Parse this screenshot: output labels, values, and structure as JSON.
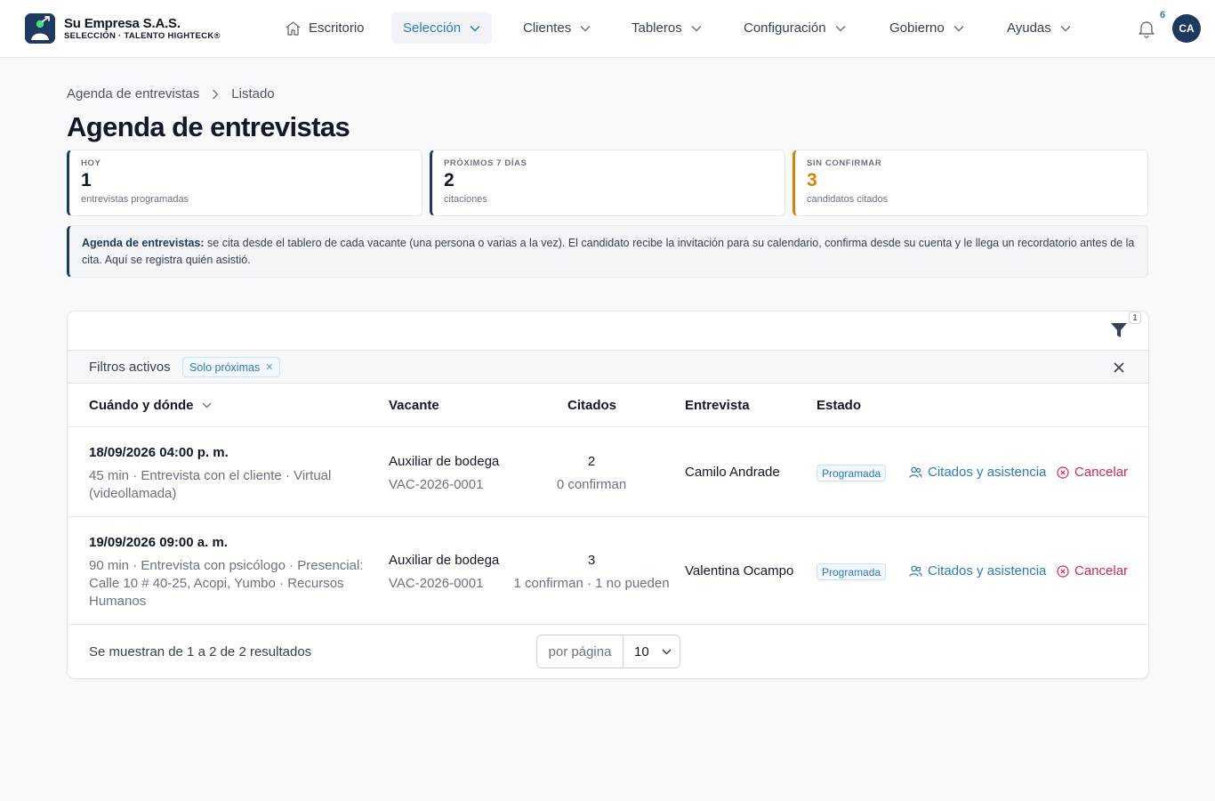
{
  "brand": {
    "name": "Su Empresa S.A.S.",
    "subtitle": "SELECCIÓN · TALENTO HIGHTECK®"
  },
  "nav": {
    "items": [
      {
        "label": "Escritorio",
        "icon": "home-icon"
      },
      {
        "label": "Selección",
        "active": true
      },
      {
        "label": "Clientes"
      },
      {
        "label": "Tableros"
      },
      {
        "label": "Configuración"
      },
      {
        "label": "Gobierno"
      },
      {
        "label": "Ayudas"
      }
    ],
    "notifications_count": "6",
    "avatar_initials": "CA"
  },
  "breadcrumb": [
    "Agenda de entrevistas",
    "Listado"
  ],
  "page_title": "Agenda de entrevistas",
  "stats": [
    {
      "label": "HOY",
      "value": "1",
      "caption": "entrevistas programadas"
    },
    {
      "label": "PRÓXIMOS 7 DÍAS",
      "value": "2",
      "caption": "citaciones"
    },
    {
      "label": "SIN CONFIRMAR",
      "value": "3",
      "caption": "candidatos citados"
    }
  ],
  "info": {
    "title": "Agenda de entrevistas:",
    "text": " se cita desde el tablero de cada vacante (una persona o varias a la vez). El candidato recibe la invitación para su calendario, confirma desde su cuenta y le llega un recordatorio antes de la cita. Aquí se registra quién asistió."
  },
  "table": {
    "filter_count": "1",
    "active_filters_label": "Filtros activos",
    "filter_chip": "Solo próximas",
    "columns": {
      "when": "Cuándo y dónde",
      "vacancy": "Vacante",
      "cited": "Citados",
      "interviewer": "Entrevista",
      "status": "Estado"
    },
    "rows": [
      {
        "date": "18/09/2026 04:00 p. m.",
        "details": "45 min · Entrevista con el cliente · Virtual (videollamada)",
        "vacancy": "Auxiliar de bodega",
        "vacancy_code": "VAC-2026-0001",
        "cited": "2",
        "cited_detail": "0 confirman",
        "interviewer": "Camilo Andrade",
        "status": "Programada",
        "action_attendance": "Citados y asistencia",
        "action_cancel": "Cancelar"
      },
      {
        "date": "19/09/2026 09:00 a. m.",
        "details": "90 min · Entrevista con psicólogo · Presencial: Calle 10 # 40-25, Acopi, Yumbo · Recursos Humanos",
        "vacancy": "Auxiliar de bodega",
        "vacancy_code": "VAC-2026-0001",
        "cited": "3",
        "cited_detail": "1 confirman · 1 no pueden",
        "interviewer": "Valentina Ocampo",
        "status": "Programada",
        "action_attendance": "Citados y asistencia",
        "action_cancel": "Cancelar"
      }
    ],
    "results_text": "Se muestran de 1 a 2 de 2 resultados",
    "per_page_label": "por página",
    "per_page_value": "10"
  },
  "colors": {
    "brand": "#1f3a5f",
    "accent": "#2d7bb8",
    "warning": "#d9820b",
    "danger": "#d2294d"
  }
}
